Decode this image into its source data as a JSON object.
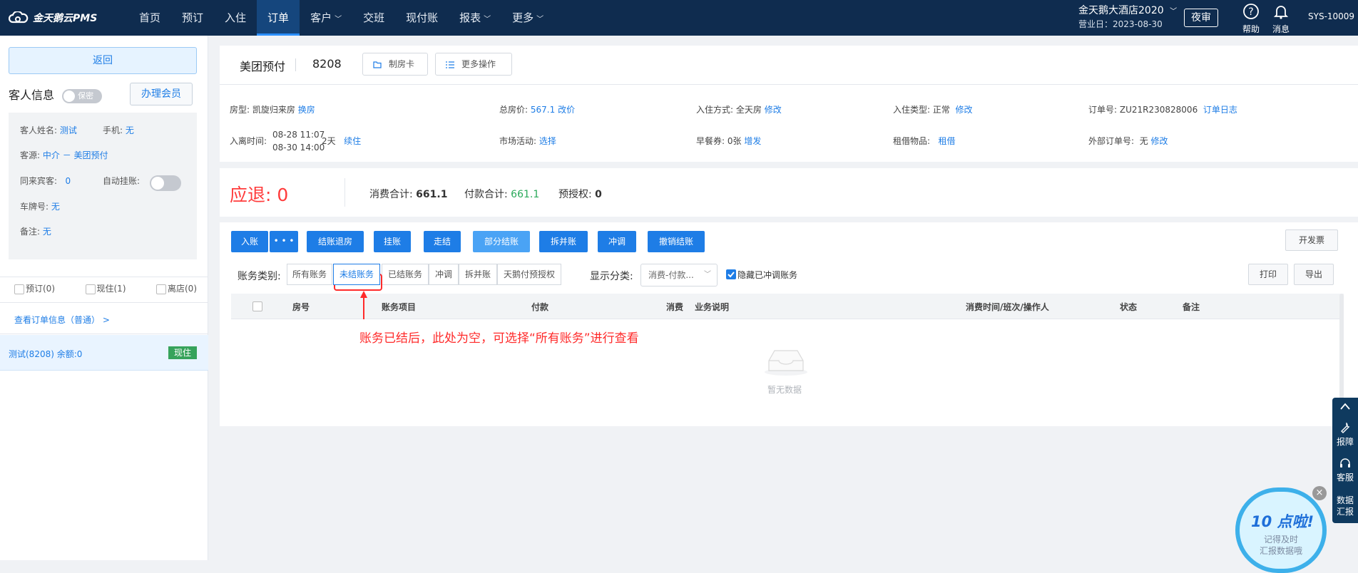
{
  "topbar": {
    "brand": "金天鹅云PMS",
    "nav": [
      {
        "label": "首页",
        "dropdown": false,
        "active": false
      },
      {
        "label": "预订",
        "dropdown": false,
        "active": false
      },
      {
        "label": "入住",
        "dropdown": false,
        "active": false
      },
      {
        "label": "订单",
        "dropdown": false,
        "active": true
      },
      {
        "label": "客户",
        "dropdown": true,
        "active": false
      },
      {
        "label": "交班",
        "dropdown": false,
        "active": false
      },
      {
        "label": "现付账",
        "dropdown": false,
        "active": false
      },
      {
        "label": "报表",
        "dropdown": true,
        "active": false
      },
      {
        "label": "更多",
        "dropdown": true,
        "active": false
      }
    ],
    "hotel_name": "金天鹅大酒店2020",
    "business_day": "营业日：2023-08-30",
    "night_audit": "夜审",
    "help": "帮助",
    "messages": "消息",
    "user": "SYS-10009"
  },
  "sidebar": {
    "back": "返回",
    "guest_info_title": "客人信息",
    "privacy_toggle": "保密",
    "member_button": "办理会员",
    "guest_name_label": "客人姓名:",
    "guest_name": "测试",
    "phone_label": "手机:",
    "phone": "无",
    "source_label": "客源:",
    "source": "中介 － 美团预付",
    "companions_label": "同来宾客:",
    "companions": "0",
    "auto_hang_label": "自动挂账:",
    "plate_label": "车牌号:",
    "plate": "无",
    "remark_label": "备注:",
    "remark": "无",
    "filters": [
      "预订(0)",
      "现住(1)",
      "离店(0)"
    ],
    "view_order": "查看订单信息（普通） >",
    "guest_entry": "测试(8208)   余额:0",
    "guest_status": "现住"
  },
  "order": {
    "channel": "美团预付",
    "room": "8208",
    "make_card": "制房卡",
    "more_ops": "更多操作",
    "room_type_label": "房型:",
    "room_type": "凯旋归来房",
    "change_room": "换房",
    "total_price_label": "总房价:",
    "total_price": "567.1",
    "change_price": "改价",
    "checkin_mode_label": "入住方式:",
    "checkin_mode": "全天房",
    "edit": "修改",
    "checkin_type_label": "入住类型:",
    "checkin_type": "正常",
    "order_no_label": "订单号:",
    "order_no": "ZU21R230828006",
    "order_log": "订单日志",
    "stay_label": "入离时间:",
    "arrive": "08-28 11:07",
    "depart": "08-30 14:00",
    "nights": "2天",
    "extend": "续住",
    "market_label": "市场活动:",
    "market": "选择",
    "breakfast_label": "早餐券:",
    "breakfast": "0张",
    "breakfast_add": "增发",
    "rent_label": "租借物品:",
    "rent": "租借",
    "ext_order_label": "外部订单号:",
    "ext_order": "无"
  },
  "summary": {
    "refund_label": "应退:",
    "refund": "0",
    "consume_label": "消费合计:",
    "consume": "661.1",
    "pay_label": "付款合计:",
    "pay": "661.1",
    "preauth_label": "预授权:",
    "preauth": "0"
  },
  "actions": {
    "checkin_post": "入账",
    "more": "• • •",
    "buttons": [
      "结账退房",
      "挂账",
      "走结",
      "部分结账",
      "拆并账",
      "冲调",
      "撤销结账"
    ],
    "invoice": "开发票"
  },
  "filter": {
    "type_label": "账务类别:",
    "segments": [
      "所有账务",
      "未结账务",
      "已结账务",
      "冲调",
      "拆并账",
      "天鹅付预授权"
    ],
    "active_index": 1,
    "display_label": "显示分类:",
    "display_value": "消费-付款...",
    "hide_reversed": "隐藏已冲调账务",
    "print": "打印",
    "export": "导出"
  },
  "table": {
    "columns": [
      "房号",
      "账务项目",
      "付款",
      "消费",
      "业务说明",
      "消费时间/班次/操作人",
      "状态",
      "备注"
    ],
    "empty": "暂无数据"
  },
  "annotation": "账务已结后，此处为空，可选择“所有账务”进行查看",
  "float_panel": {
    "report_fault": "报障",
    "support": "客服",
    "data": "数据\n汇报"
  },
  "promo": {
    "headline": "10 点啦!",
    "line1": "记得及时",
    "line2": "汇报数据哦"
  },
  "colors": {
    "topbar": "#0f2c4f",
    "accent": "#1e7de6",
    "refund": "#ff3b3b",
    "pay": "#2aa95a",
    "status_tag": "#36a35b",
    "annotation": "#ff2a2a"
  }
}
